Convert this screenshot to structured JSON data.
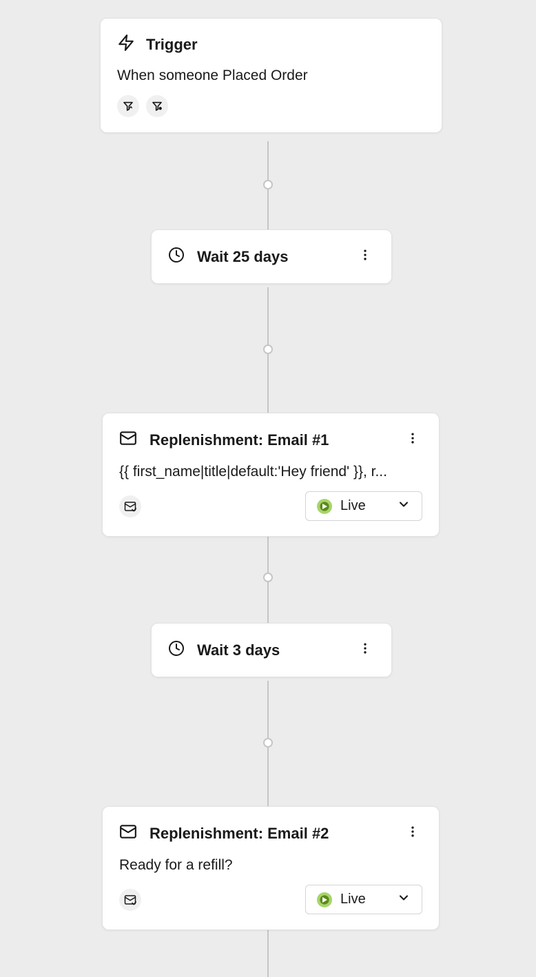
{
  "trigger": {
    "title": "Trigger",
    "description": "When someone Placed Order"
  },
  "wait1": {
    "label": "Wait 25 days"
  },
  "email1": {
    "title": "Replenishment: Email #1",
    "preview": "{{ first_name|title|default:'Hey friend' }}, r...",
    "status": "Live"
  },
  "wait2": {
    "label": "Wait 3 days"
  },
  "email2": {
    "title": "Replenishment: Email #2",
    "preview": "Ready for a refill?",
    "status": "Live"
  }
}
